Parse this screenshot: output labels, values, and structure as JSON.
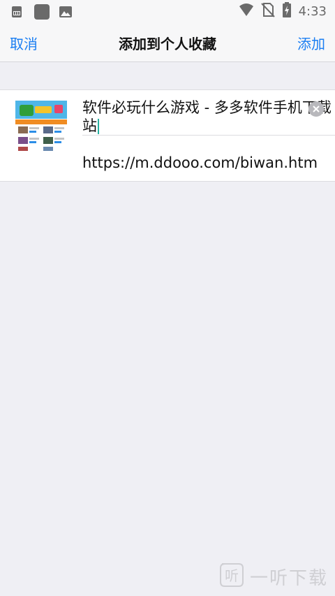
{
  "status_bar": {
    "time": "4:33",
    "left_icons": [
      "sim-card-icon",
      "app-square-icon",
      "image-icon"
    ],
    "right_icons": [
      "wifi-icon",
      "no-sim-icon",
      "battery-charging-icon"
    ]
  },
  "nav": {
    "cancel_label": "取消",
    "title": "添加到个人收藏",
    "add_label": "添加",
    "accent_color": "#1a7ef2"
  },
  "bookmark": {
    "title": "软件必玩什么游戏 - 多多软件手机下载站",
    "url": "https://m.ddooo.com/biwan.htm",
    "thumbnail": "site-preview-thumbnail",
    "clear_icon": "clear-icon"
  },
  "watermark": {
    "text": "一听下载",
    "icon": "ting-logo-icon"
  }
}
